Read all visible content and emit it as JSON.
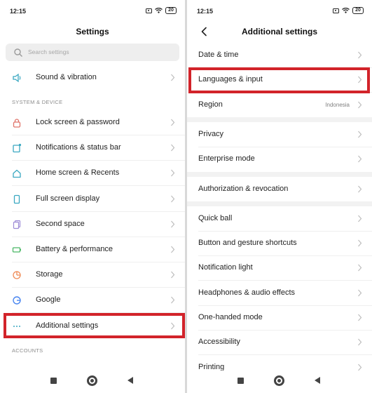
{
  "status_bar": {
    "time": "12:15",
    "battery": "20"
  },
  "settings": {
    "title": "Settings",
    "search_placeholder": "Search settings",
    "top_items": [
      {
        "label": "Sound & vibration",
        "icon": "speaker-icon"
      }
    ],
    "section_system": "SYSTEM & DEVICE",
    "system_items": [
      {
        "label": "Lock screen & password",
        "icon": "lock-icon"
      },
      {
        "label": "Notifications & status bar",
        "icon": "notifications-icon"
      },
      {
        "label": "Home screen & Recents",
        "icon": "home-icon"
      },
      {
        "label": "Full screen display",
        "icon": "phone-icon"
      },
      {
        "label": "Second space",
        "icon": "second-space-icon"
      },
      {
        "label": "Battery & performance",
        "icon": "battery-icon"
      },
      {
        "label": "Storage",
        "icon": "storage-icon"
      },
      {
        "label": "Google",
        "icon": "google-icon"
      },
      {
        "label": "Additional settings",
        "icon": "more-dots-icon"
      }
    ],
    "section_accounts": "ACCOUNTS"
  },
  "additional": {
    "title": "Additional settings",
    "groups": [
      [
        {
          "label": "Date & time"
        },
        {
          "label": "Languages & input"
        },
        {
          "label": "Region",
          "value": "Indonesia"
        }
      ],
      [
        {
          "label": "Privacy"
        },
        {
          "label": "Enterprise mode"
        }
      ],
      [
        {
          "label": "Authorization & revocation"
        }
      ],
      [
        {
          "label": "Quick ball"
        },
        {
          "label": "Button and gesture shortcuts"
        },
        {
          "label": "Notification light"
        },
        {
          "label": "Headphones & audio effects"
        },
        {
          "label": "One-handed mode"
        },
        {
          "label": "Accessibility"
        },
        {
          "label": "Printing"
        }
      ]
    ]
  },
  "colors": {
    "highlight": "#d2232a",
    "accent_icon": "#3aa8c1",
    "chevron": "#bdbdbd"
  }
}
